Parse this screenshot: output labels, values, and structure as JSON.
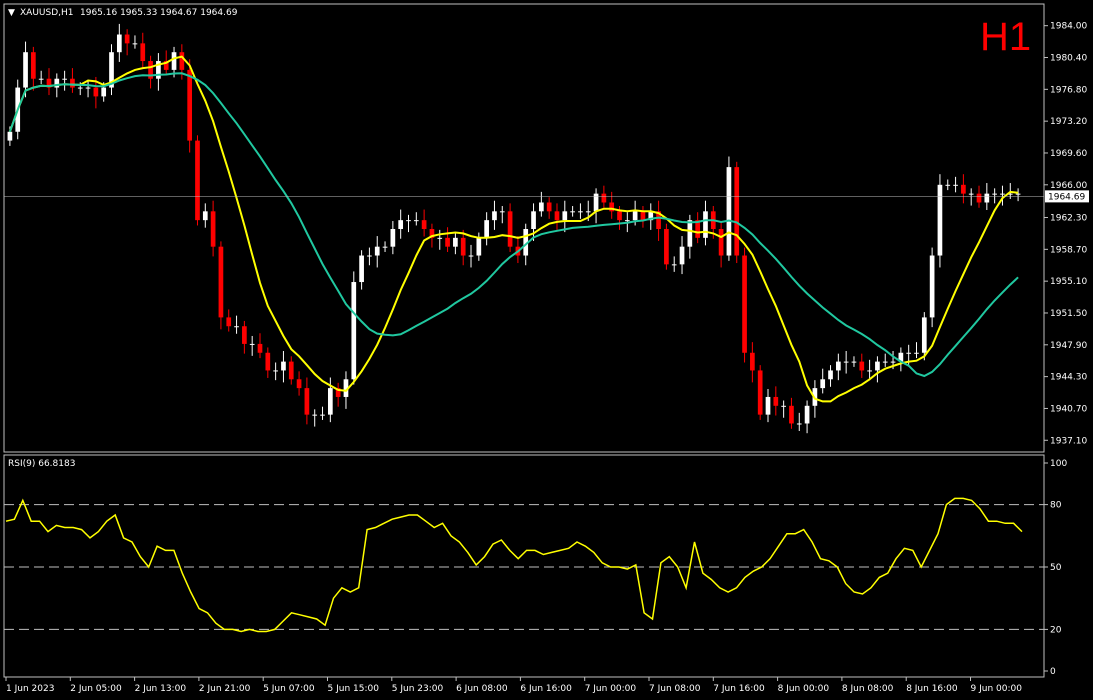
{
  "header": {
    "symbol": "XAUUSD,H1",
    "ohlc": "1965.16 1965.33 1964.67 1964.69",
    "timeframe_badge": "H1"
  },
  "colors": {
    "background": "#000000",
    "bull": "#ffffff",
    "bear": "#ff0000",
    "ma_fast": "#ffff00",
    "ma_slow": "#20c8a0",
    "rsi": "#ffff00",
    "grid": "#c0c0c0"
  },
  "chart_data": [
    {
      "type": "candlestick",
      "title": "XAUUSD,H1",
      "ylim": [
        1936.0,
        1986.0
      ],
      "price_ticks": [
        "1984.00",
        "1980.40",
        "1976.80",
        "1973.20",
        "1969.60",
        "1966.00",
        "1962.30",
        "1958.70",
        "1955.10",
        "1951.50",
        "1947.90",
        "1944.30",
        "1940.70",
        "1937.10"
      ],
      "current_price": "1964.69",
      "x_labels": [
        "1 Jun 2023",
        "2 Jun 05:00",
        "2 Jun 13:00",
        "2 Jun 21:00",
        "5 Jun 07:00",
        "5 Jun 15:00",
        "5 Jun 23:00",
        "6 Jun 08:00",
        "6 Jun 16:00",
        "7 Jun 00:00",
        "7 Jun 08:00",
        "7 Jun 16:00",
        "8 Jun 00:00",
        "8 Jun 08:00",
        "8 Jun 16:00",
        "9 Jun 00:00"
      ],
      "series": [
        {
          "name": "Price",
          "close": [
            1972,
            1977,
            1981,
            1978,
            1978,
            1977,
            1978,
            1978,
            1977,
            1977,
            1977,
            1976,
            1977,
            1981,
            1983,
            1982,
            1982,
            1980,
            1978,
            1980,
            1979,
            1981,
            1979,
            1971,
            1962,
            1963,
            1959,
            1951,
            1950,
            1950,
            1948,
            1948,
            1947,
            1945,
            1945,
            1946,
            1944,
            1943,
            1940,
            1940,
            1940,
            1943,
            1942,
            1944,
            1955,
            1958,
            1958,
            1959,
            1959,
            1961,
            1962,
            1962,
            1962,
            1961,
            1960,
            1960,
            1959,
            1960,
            1958,
            1958,
            1960,
            1962,
            1963,
            1963,
            1959,
            1958,
            1961,
            1963,
            1964,
            1963,
            1962,
            1963,
            1963,
            1963,
            1963,
            1965,
            1964,
            1963,
            1962,
            1962,
            1963,
            1962,
            1963,
            1961,
            1957,
            1957,
            1959,
            1962,
            1960,
            1963,
            1961,
            1958,
            1968,
            1958,
            1947,
            1945,
            1940,
            1942,
            1941,
            1941,
            1939,
            1939,
            1941,
            1943,
            1944,
            1945,
            1946,
            1946,
            1946,
            1945,
            1945,
            1946,
            1946,
            1946,
            1947,
            1947,
            1947,
            1951,
            1958,
            1966,
            1966,
            1966,
            1965,
            1965,
            1964,
            1965,
            1965,
            1965,
            1965,
            1965
          ]
        }
      ]
    },
    {
      "type": "line",
      "title": "RSI(9) 66.8183",
      "ylim": [
        0,
        100
      ],
      "y_ticks": [
        "100",
        "80",
        "50",
        "20",
        "0"
      ],
      "levels": [
        80,
        50,
        20
      ],
      "series": [
        {
          "name": "RSI(9)",
          "values": [
            72,
            73,
            82,
            72,
            72,
            67,
            70,
            69,
            69,
            68,
            64,
            67,
            72,
            75,
            64,
            62,
            55,
            50,
            60,
            58,
            58,
            47,
            38,
            30,
            28,
            23,
            20,
            20,
            19,
            20,
            19,
            19,
            20,
            24,
            28,
            27,
            26,
            25,
            22,
            35,
            40,
            38,
            40,
            68,
            69,
            71,
            73,
            74,
            75,
            75,
            72,
            69,
            71,
            65,
            62,
            57,
            51,
            55,
            61,
            63,
            58,
            54,
            58,
            58,
            56,
            57,
            58,
            59,
            62,
            60,
            57,
            52,
            50,
            50,
            49,
            51,
            28,
            25,
            52,
            55,
            50,
            40,
            62,
            47,
            44,
            40,
            38,
            40,
            45,
            48,
            50,
            54,
            60,
            66,
            66,
            68,
            62,
            54,
            53,
            50,
            42,
            38,
            37,
            40,
            45,
            47,
            54,
            59,
            58,
            50,
            58,
            66,
            80,
            83,
            83,
            82,
            78,
            72,
            72,
            71,
            71,
            67
          ]
        }
      ]
    }
  ],
  "rsi_label": "RSI(9) 66.8183"
}
